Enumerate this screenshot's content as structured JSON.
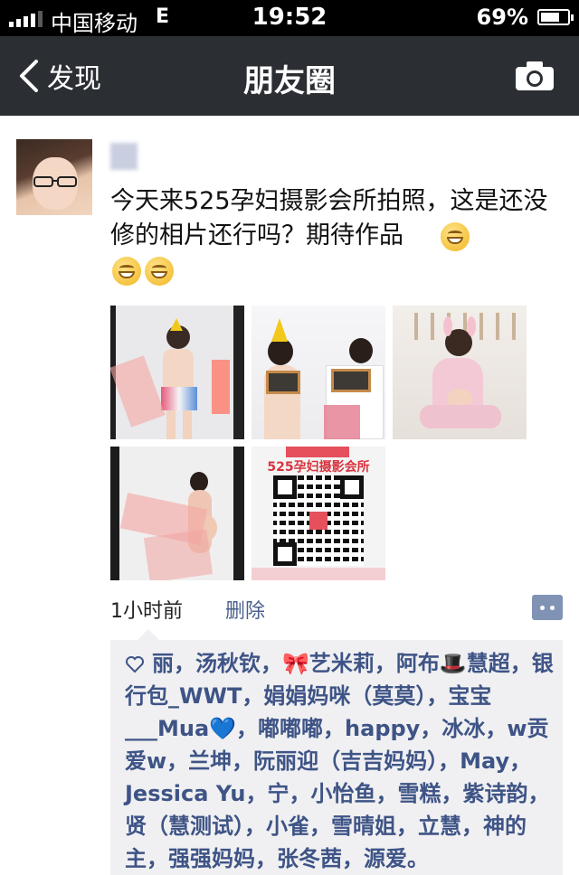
{
  "status_bar": {
    "carrier": "中国移动",
    "network": "E",
    "time": "19:52",
    "battery_percent": "69%",
    "battery_level": 0.69
  },
  "nav": {
    "back_label": "发现",
    "title": "朋友圈",
    "camera_icon": "camera-icon"
  },
  "post": {
    "text": "今天来525孕妇摄影会所拍照，这是还没修的相片还行吗？期待作品",
    "emoji_count": 3,
    "photos": [
      {
        "name": "photo-1"
      },
      {
        "name": "photo-2"
      },
      {
        "name": "photo-3"
      },
      {
        "name": "photo-4"
      },
      {
        "name": "photo-5",
        "text": "525孕妇摄影会所"
      }
    ],
    "time_ago": "1小时前",
    "delete_label": "删除",
    "likes_text": "丽，汤秋钦，🎀艺米莉，阿布🎩慧超，银行包_WWT，娟娟妈咪（莫莫），宝宝___Mua💙，嘟嘟嘟，happy，冰冰，w贡爱w，兰坤，阮丽迎（吉吉妈妈），May，Jessica Yu，宁，小怡鱼，雪糕，紫诗韵，贤（慧测试），小雀，雪晴姐，立慧，神的主，强强妈妈，张冬茜，源爱。"
  },
  "colors": {
    "nav_bg": "#2b2f33",
    "link": "#3e5486",
    "likes_bg": "#f0f0f2"
  }
}
